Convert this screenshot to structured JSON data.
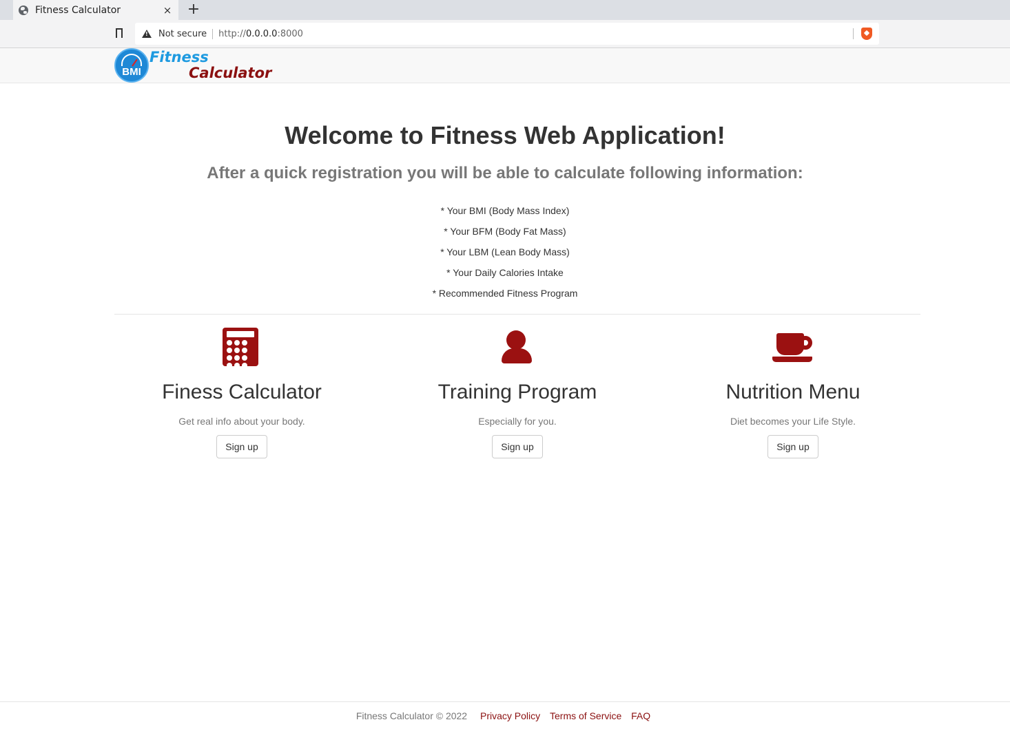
{
  "browser": {
    "tab_title": "Fitness Calculator",
    "tab_close": "×",
    "new_tab": "+",
    "security_label": "Not secure",
    "url_proto": "http://",
    "url_host": "0.0.0.0",
    "url_port": ":8000"
  },
  "navbar": {
    "logo_badge": "BMI",
    "logo_line1": "Fitness",
    "logo_line2": "Calculator"
  },
  "hero": {
    "title": "Welcome to Fitness Web Application!",
    "subtitle": "After a quick registration you will be able to calculate following information:",
    "features": [
      "* Your BMI (Body Mass Index)",
      "* Your BFM (Body Fat Mass)",
      "* Your LBM (Lean Body Mass)",
      "* Your Daily Calories Intake",
      "* Recommended Fitness Program"
    ]
  },
  "columns": [
    {
      "icon": "calculator-icon",
      "title": "Finess Calculator",
      "desc": "Get real info about your body.",
      "button": "Sign up"
    },
    {
      "icon": "user-icon",
      "title": "Training Program",
      "desc": "Especially for you.",
      "button": "Sign up"
    },
    {
      "icon": "coffee-icon",
      "title": "Nutrition Menu",
      "desc": "Diet becomes your Life Style.",
      "button": "Sign up"
    }
  ],
  "footer": {
    "copyright": "Fitness Calculator © 2022",
    "links": [
      "Privacy Policy",
      "Terms of Service",
      "FAQ"
    ]
  },
  "colors": {
    "accent": "#8b1010",
    "icon": "#9b1111",
    "logo_blue": "#1e9ae0"
  }
}
